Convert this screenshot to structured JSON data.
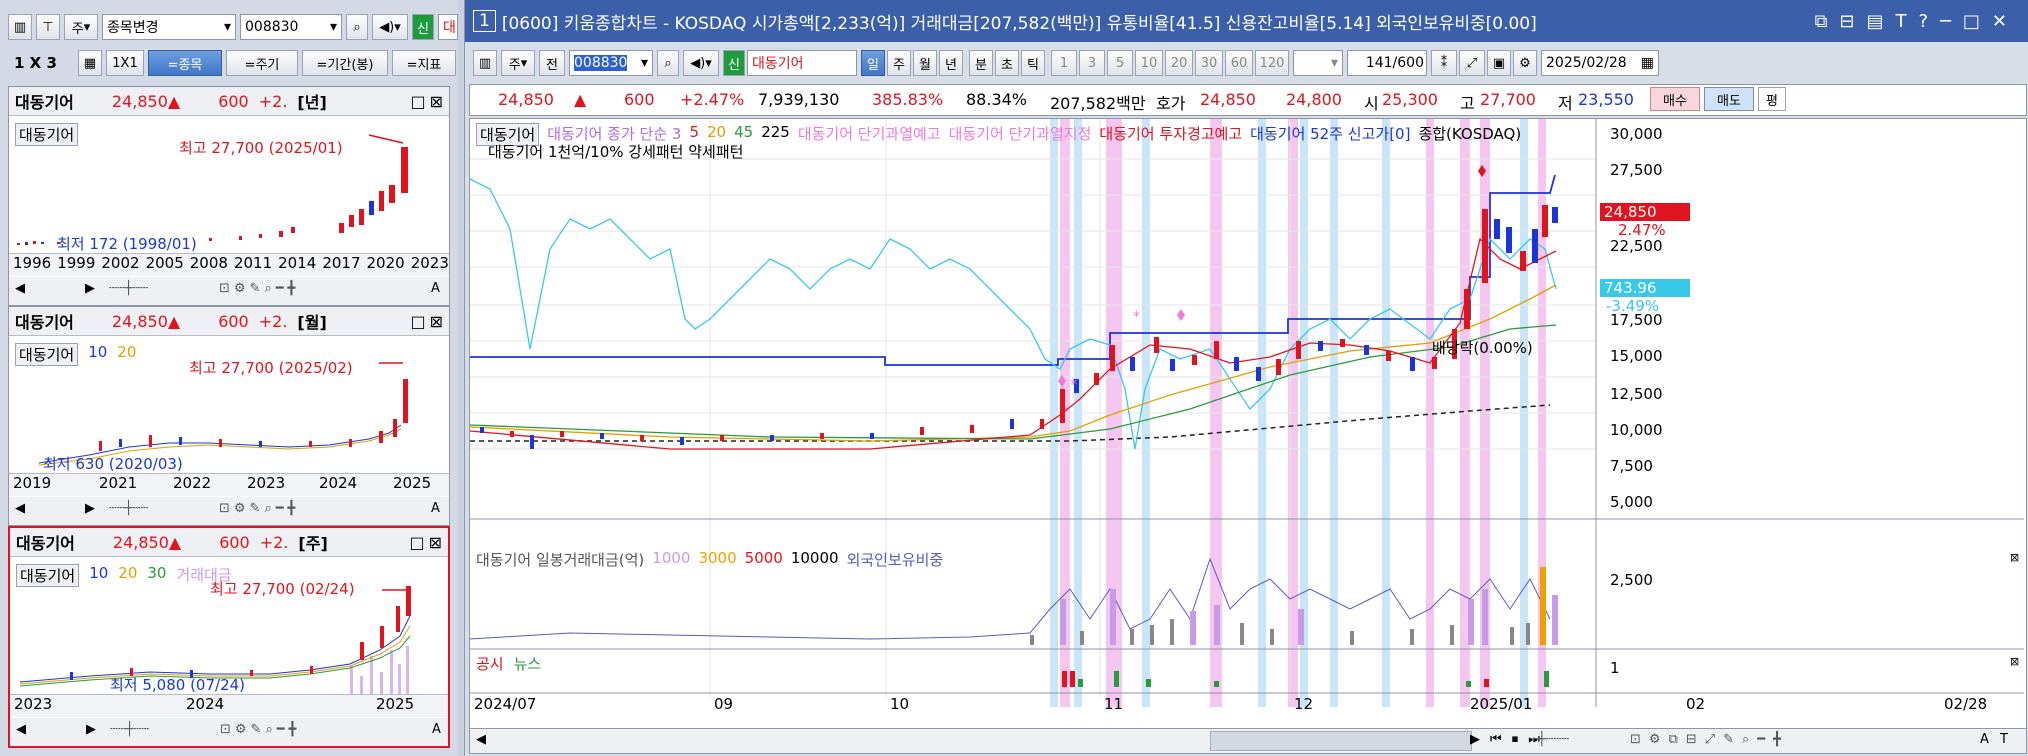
{
  "left": {
    "toolbar": {
      "period": "주",
      "mode_label": "종목변경",
      "code": "008830",
      "sin": "신",
      "name_partial": "대"
    },
    "row2": {
      "grid": "1 X 3",
      "one": "1X1",
      "btns": [
        "=종목",
        "=주기",
        "=기간(봉)",
        "=지표"
      ]
    },
    "panels": [
      {
        "name": "대동기어",
        "price": "24,850",
        "arrow": "▲",
        "change": "600",
        "pct": "+2.",
        "period": "[년]",
        "legend": [
          "대동기어"
        ],
        "max_label": "최고 27,700 (2025/01)",
        "min_label": "최저 172 (1998/01)",
        "x_ticks": [
          "1996",
          "1999",
          "2002",
          "2005",
          "2008",
          "2011",
          "2014",
          "2017",
          "2020",
          "2023"
        ]
      },
      {
        "name": "대동기어",
        "price": "24,850",
        "arrow": "▲",
        "change": "600",
        "pct": "+2.",
        "period": "[월]",
        "legend": [
          "대동기어",
          "10",
          "20"
        ],
        "max_label": "최고 27,700 (2025/02)",
        "min_label": "최저 630 (2020/03)",
        "x_ticks": [
          "2019",
          "2021",
          "2022",
          "2023",
          "2024",
          "2025"
        ]
      },
      {
        "name": "대동기어",
        "price": "24,850",
        "arrow": "▲",
        "change": "600",
        "pct": "+2.",
        "period": "[주]",
        "legend": [
          "대동기어",
          "10",
          "20",
          "30",
          "거래대금"
        ],
        "max_label": "최고 27,700 (02/24)",
        "min_label": "최저 5,080 (07/24)",
        "x_ticks": [
          "2023",
          "2024",
          "2025"
        ]
      }
    ],
    "scroll_letter": "A"
  },
  "main": {
    "title_num": "1",
    "title": "[0600] 키움종합차트 - KOSDAQ 시가총액[2,233(억)] 거래대금[207,582(백만)] 유통비율[41.5] 신용잔고비율[5.14] 외국인보유비중[0.00]",
    "toolbar": {
      "period": "주",
      "prev": "전",
      "code": "008830",
      "sin": "신",
      "name": "대동기어",
      "periods": [
        "일",
        "주",
        "월",
        "년",
        "분",
        "초",
        "틱"
      ],
      "active_period": "일",
      "nums": [
        "1",
        "3",
        "5",
        "10",
        "20",
        "30",
        "60",
        "120"
      ],
      "count": "141",
      "count_total": "/600",
      "date": "2025/02/28"
    },
    "quote": {
      "price": "24,850",
      "arrow": "▲",
      "change": "600",
      "pct": "+2.47%",
      "volume": "7,939,130",
      "vol_ratio": "385.83%",
      "turnover": "88.34%",
      "amount": "207,582백만",
      "hoga_label": "호가",
      "ask": "24,850",
      "bid": "24,800",
      "open_label": "시",
      "open": "25,300",
      "high_label": "고",
      "high": "27,700",
      "low_label": "저",
      "low": "23,550",
      "buy": "매수",
      "sell": "매도",
      "avg": "평"
    },
    "legend1": [
      {
        "text": "대동기어",
        "color": "#000000"
      },
      {
        "text": "대동기어 종가 단순 3",
        "color": "#b06be0"
      },
      {
        "text": "5",
        "color": "#e0141e"
      },
      {
        "text": "20",
        "color": "#e0a000"
      },
      {
        "text": "45",
        "color": "#2a9a3a"
      },
      {
        "text": "225",
        "color": "#000000"
      },
      {
        "text": "대동기어 단기과열예고",
        "color": "#f07ad8"
      },
      {
        "text": "대동기어 단기과열지정",
        "color": "#f07ad8"
      },
      {
        "text": "대동기어 투자경고예고",
        "color": "#e0141e"
      },
      {
        "text": "대동기어 52주 신고가[0]",
        "color": "#1b35d8"
      },
      {
        "text": "종합(KOSDAQ)",
        "color": "#000000"
      }
    ],
    "legend2": "대동기어 1천억/10% 강세패턴 약세패턴",
    "dividend_label": "배당락(0.00%)",
    "y_ticks": [
      "30,000",
      "27,500",
      "22,500",
      "17,500",
      "15,000",
      "12,500",
      "10,000",
      "7,500",
      "5,000"
    ],
    "price_tag": "24,850",
    "pct_tag": "2.47%",
    "index_tag": "743.96",
    "index_pct_tag": "-3.49%",
    "vol_legend": [
      {
        "text": "대동기어 일봉거래대금(억)",
        "color": "#555555"
      },
      {
        "text": "1000",
        "color": "#c79be8"
      },
      {
        "text": "3000",
        "color": "#f0a000"
      },
      {
        "text": "5000",
        "color": "#e0141e"
      },
      {
        "text": "10000",
        "color": "#000000"
      },
      {
        "text": "외국인보유비중",
        "color": "#5a5ac0"
      }
    ],
    "vol_y": "2,500",
    "news_legend": [
      {
        "text": "공시",
        "color": "#e0141e"
      },
      {
        "text": "뉴스",
        "color": "#2a9a3a"
      }
    ],
    "news_y": "1",
    "x_labels": [
      "2024/07",
      "09",
      "10",
      "11",
      "12",
      "2025/01",
      "02"
    ],
    "x_end": "02/28",
    "bottom_letters": [
      "A",
      "T"
    ]
  },
  "colors": {
    "up": "#e0141e",
    "down": "#1b35d8",
    "cyan": "#38c8e8",
    "pink_band": "#f5c6f0",
    "blue_band": "#c8e6f8",
    "title_bar": "#3b5fa8"
  }
}
